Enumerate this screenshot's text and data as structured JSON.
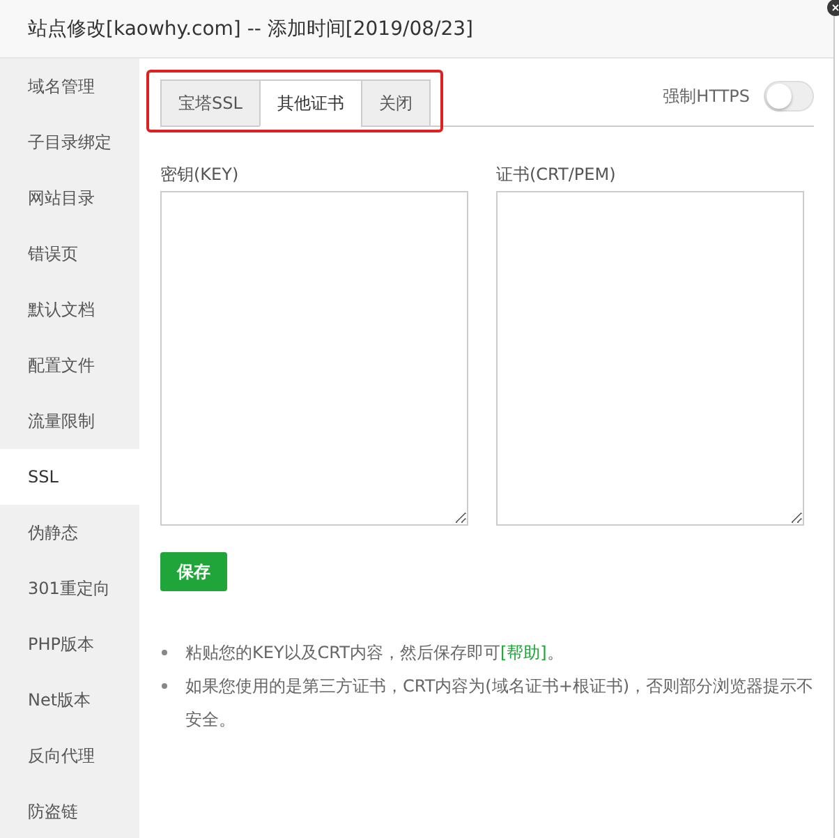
{
  "window": {
    "title": "站点修改[kaowhy.com] -- 添加时间[2019/08/23]"
  },
  "sidebar": {
    "items": [
      {
        "label": "域名管理",
        "selected": false
      },
      {
        "label": "子目录绑定",
        "selected": false
      },
      {
        "label": "网站目录",
        "selected": false
      },
      {
        "label": "错误页",
        "selected": false
      },
      {
        "label": "默认文档",
        "selected": false
      },
      {
        "label": "配置文件",
        "selected": false
      },
      {
        "label": "流量限制",
        "selected": false
      },
      {
        "label": "SSL",
        "selected": true
      },
      {
        "label": "伪静态",
        "selected": false
      },
      {
        "label": "301重定向",
        "selected": false
      },
      {
        "label": "PHP版本",
        "selected": false
      },
      {
        "label": "Net版本",
        "selected": false
      },
      {
        "label": "反向代理",
        "selected": false
      },
      {
        "label": "防盗链",
        "selected": false
      }
    ]
  },
  "tabs": [
    {
      "label": "宝塔SSL",
      "selected": false
    },
    {
      "label": "其他证书",
      "selected": true
    },
    {
      "label": "关闭",
      "selected": false
    }
  ],
  "force_https": {
    "label": "强制HTTPS",
    "on": false
  },
  "fields": [
    {
      "label": "密钥(KEY)"
    },
    {
      "label": "证书(CRT/PEM)"
    }
  ],
  "save_button": "保存",
  "notes": [
    {
      "text": "粘贴您的KEY以及CRT内容，然后保存即可",
      "link": "[帮助]",
      "after": "。"
    },
    {
      "text": "如果您使用的是第三方证书，CRT内容为(域名证书+根证书)，否则部分浏览器提示不安全。"
    }
  ]
}
